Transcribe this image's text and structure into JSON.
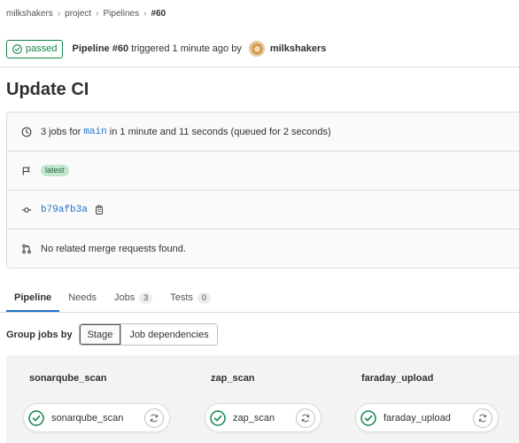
{
  "breadcrumb": {
    "items": [
      "milkshakers",
      "project",
      "Pipelines",
      "#60"
    ]
  },
  "pipeline": {
    "status": "passed",
    "id_label": "Pipeline #60",
    "triggered_text": "triggered 1 minute ago by",
    "user": "milkshakers",
    "title": "Update CI"
  },
  "info": {
    "jobs_prefix": "3 jobs for",
    "branch": "main",
    "jobs_suffix": "in 1 minute and 11 seconds (queued for 2 seconds)",
    "tag": "latest",
    "commit": "b79afb3a",
    "merge_requests": "No related merge requests found."
  },
  "tabs": [
    {
      "label": "Pipeline",
      "count": null
    },
    {
      "label": "Needs",
      "count": null
    },
    {
      "label": "Jobs",
      "count": "3"
    },
    {
      "label": "Tests",
      "count": "0"
    }
  ],
  "group_by": {
    "label": "Group jobs by",
    "options": [
      "Stage",
      "Job dependencies"
    ]
  },
  "stages": [
    {
      "name": "sonarqube_scan",
      "job": "sonarqube_scan"
    },
    {
      "name": "zap_scan",
      "job": "zap_scan"
    },
    {
      "name": "faraday_upload",
      "job": "faraday_upload"
    }
  ],
  "colors": {
    "success": "#108548",
    "link": "#1f75cb",
    "active_tab": "#1f75cb"
  },
  "icons": {
    "status": "status-success-icon",
    "clock": "clock-icon",
    "flag": "flag-icon",
    "commit": "commit-icon",
    "copy": "copy-icon",
    "merge_request": "merge-request-icon",
    "retry": "retry-icon"
  }
}
